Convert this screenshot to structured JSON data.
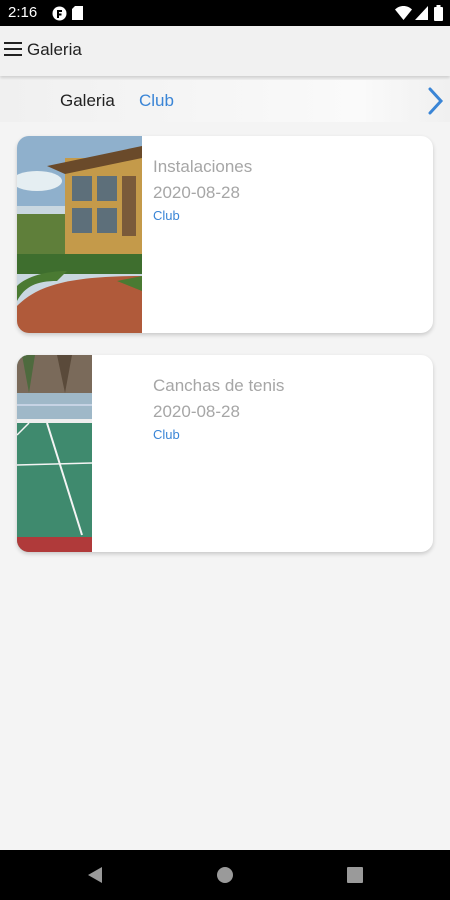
{
  "status_bar": {
    "time": "2:16"
  },
  "app_bar": {
    "title": "Galeria"
  },
  "tabs": [
    {
      "label": "Galeria",
      "active": false
    },
    {
      "label": "Club",
      "active": true
    }
  ],
  "gallery": [
    {
      "title": "Instalaciones",
      "date": "2020-08-28",
      "category": "Club",
      "image": "building-photo"
    },
    {
      "title": "Canchas de tenis",
      "date": "2020-08-28",
      "category": "Club",
      "image": "tennis-court-photo"
    }
  ],
  "colors": {
    "accent": "#3a85d6",
    "muted_text": "#a6a6a6",
    "background": "#f4f4f4"
  }
}
